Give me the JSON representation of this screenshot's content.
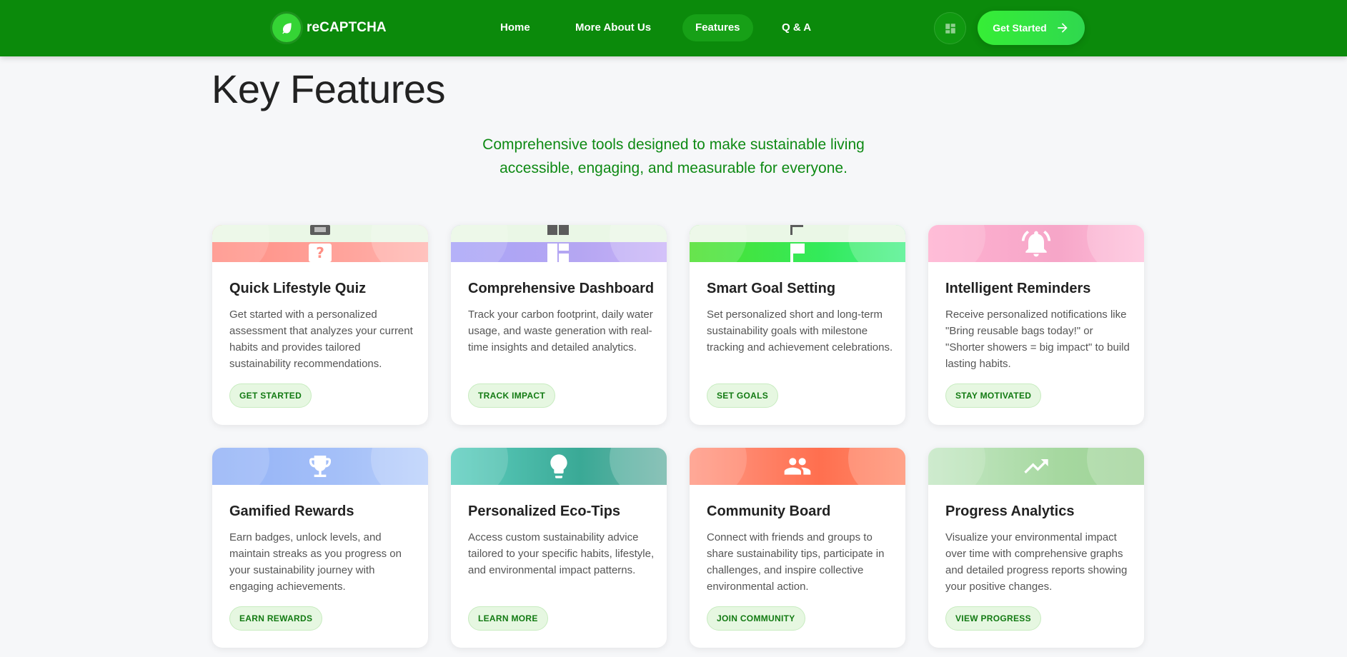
{
  "nav": {
    "brand": "reCAPTCHA",
    "links": [
      "Home",
      "More About Us",
      "Features",
      "Q & A"
    ],
    "active_link": "Features",
    "cta_label": "Get Started"
  },
  "page": {
    "title": "Key Features",
    "subtitle_line1": "Comprehensive tools designed to make sustainable living",
    "subtitle_line2": "accessible, engaging, and measurable for everyone."
  },
  "colors": {
    "nav_bg": "#0b8a0b",
    "accent": "#2fd84f",
    "subtitle": "#0e8a14"
  },
  "cards": [
    {
      "title": "Quick Lifestyle Quiz",
      "desc": "Get started with a personalized assessment that analyzes your current habits and provides tailored sustainability recommendations.",
      "button": "GET STARTED",
      "icon": "quiz-icon"
    },
    {
      "title": "Comprehensive Dashboard",
      "desc": "Track your carbon footprint, daily water usage, and waste generation with real-time insights and detailed analytics.",
      "button": "TRACK IMPACT",
      "icon": "dashboard-icon"
    },
    {
      "title": "Smart Goal Setting",
      "desc": "Set personalized short and long-term sustainability goals with milestone tracking and achievement celebrations.",
      "button": "SET GOALS",
      "icon": "flag-icon"
    },
    {
      "title": "Intelligent Reminders",
      "desc": "Receive personalized notifications like \"Bring reusable bags today!\" or \"Shorter showers = big impact\" to build lasting habits.",
      "button": "STAY MOTIVATED",
      "icon": "bell-icon"
    },
    {
      "title": "Gamified Rewards",
      "desc": "Earn badges, unlock levels, and maintain streaks as you progress on your sustainability journey with engaging achievements.",
      "button": "EARN REWARDS",
      "icon": "trophy-icon"
    },
    {
      "title": "Personalized Eco-Tips",
      "desc": "Access custom sustainability advice tailored to your specific habits, lifestyle, and environmental impact patterns.",
      "button": "LEARN MORE",
      "icon": "lightbulb-icon"
    },
    {
      "title": "Community Board",
      "desc": "Connect with friends and groups to share sustainability tips, participate in challenges, and inspire collective environmental action.",
      "button": "JOIN COMMUNITY",
      "icon": "people-icon"
    },
    {
      "title": "Progress Analytics",
      "desc": "Visualize your environmental impact over time with comprehensive graphs and detailed progress reports showing your positive changes.",
      "button": "VIEW PROGRESS",
      "icon": "trending-up-icon"
    }
  ]
}
